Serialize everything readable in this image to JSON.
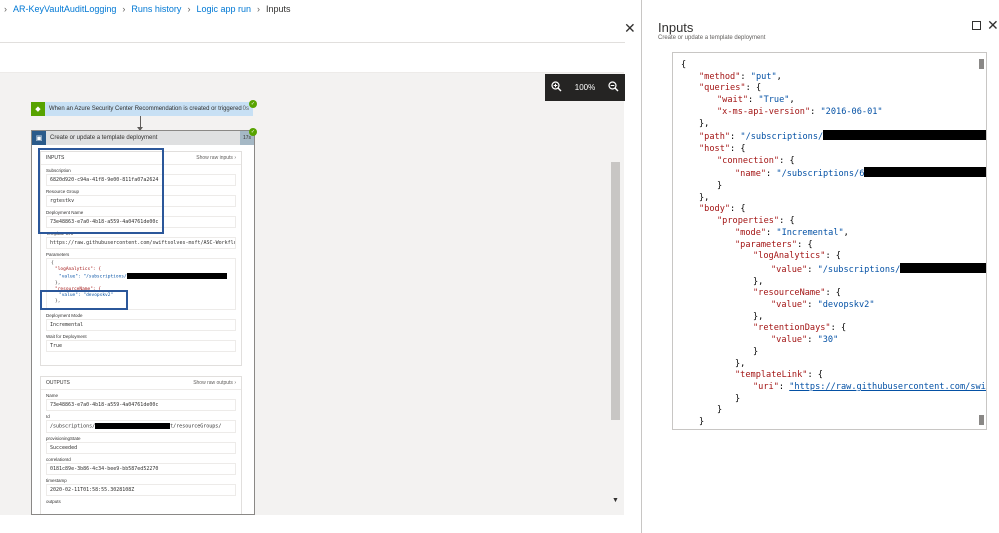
{
  "breadcrumb": [
    "AR-KeyVaultAuditLogging",
    "Runs history",
    "Logic app run",
    "Inputs"
  ],
  "designer": {
    "zoom_level": "100%",
    "trigger": {
      "title": "When an Azure Security Center Recommendation is created or triggered",
      "duration": "0s"
    },
    "action": {
      "title": "Create or update a template deployment",
      "duration": "17s",
      "inputs": {
        "title": "INPUTS",
        "show_raw": "Show raw inputs",
        "subscription_label": "Subscription",
        "subscription_value": "6820d920-c94a-41f8-9e00-811fa07a2624",
        "rg_label": "Resource Group",
        "rg_value": "rgtestkv",
        "deployment_label": "Deployment Name",
        "deployment_value": "73e48863-e7a0-4b18-a559-4a04761de00c",
        "template_uri_label": "Template URI",
        "template_uri_value": "https://raw.githubusercontent.com/swiftsolves-msft/ASC-Workflow-Aut",
        "parameters_label": "Parameters",
        "parameters_lines": [
          "{",
          "\"logAnalytics\": {",
          "\"value\": \"/subscriptions/",
          "},",
          "\"resourceName\": {",
          "\"value\": \"devopskv2\"",
          "},"
        ],
        "mode_label": "Deployment Mode",
        "mode_value": "Incremental",
        "wait_label": "Wait for Deployment",
        "wait_value": "True"
      },
      "outputs": {
        "title": "OUTPUTS",
        "show_raw": "Show raw outputs",
        "name_label": "Name",
        "name_value": "73e48863-e7a0-4b18-a559-4a04761de00c",
        "id_label": "Id",
        "id_value_prefix": "/subscriptions/",
        "id_value_suffix": "t/resourceGroups/",
        "state_label": "provisioningState",
        "state_value": "Succeeded",
        "corr_label": "correlationId",
        "corr_value": "0181c89e-3b86-4c34-bee9-bb587ed52270",
        "ts_label": "timestamp",
        "ts_value": "2020-02-11T01:58:55.3028108Z",
        "outputs_label": "outputs"
      }
    }
  },
  "inputs_panel": {
    "title": "Inputs",
    "subtitle": "Create or update a template deployment",
    "json_lines": [
      {
        "i": 0,
        "p": "{"
      },
      {
        "i": 1,
        "k": "\"method\"",
        "v": "\"put\"",
        "e": ","
      },
      {
        "i": 1,
        "k": "\"queries\"",
        "e": "{"
      },
      {
        "i": 2,
        "k": "\"wait\"",
        "v": "\"True\"",
        "e": ","
      },
      {
        "i": 2,
        "k": "\"x-ms-api-version\"",
        "v": "\"2016-06-01\""
      },
      {
        "i": 1,
        "p": "},"
      },
      {
        "i": 1,
        "k": "\"path\"",
        "v": "\"/subscriptions/",
        "r": 170,
        "t": "/r"
      },
      {
        "i": 1,
        "k": "\"host\"",
        "e": "{"
      },
      {
        "i": 2,
        "k": "\"connection\"",
        "e": "{"
      },
      {
        "i": 3,
        "k": "\"name\"",
        "v": "\"/subscriptions/6",
        "r": 140
      },
      {
        "i": 2,
        "p": "}"
      },
      {
        "i": 1,
        "p": "},"
      },
      {
        "i": 1,
        "k": "\"body\"",
        "e": "{"
      },
      {
        "i": 2,
        "k": "\"properties\"",
        "e": "{"
      },
      {
        "i": 3,
        "k": "\"mode\"",
        "v": "\"Incremental\"",
        "e": ","
      },
      {
        "i": 3,
        "k": "\"parameters\"",
        "e": "{"
      },
      {
        "i": 4,
        "k": "\"logAnalytics\"",
        "e": "{"
      },
      {
        "i": 5,
        "k": "\"value\"",
        "v": "\"/subscriptions/",
        "r": 100
      },
      {
        "i": 4,
        "p": "},"
      },
      {
        "i": 4,
        "k": "\"resourceName\"",
        "e": "{"
      },
      {
        "i": 5,
        "k": "\"value\"",
        "v": "\"devopskv2\""
      },
      {
        "i": 4,
        "p": "},"
      },
      {
        "i": 4,
        "k": "\"retentionDays\"",
        "e": "{"
      },
      {
        "i": 5,
        "k": "\"value\"",
        "v": "\"30\""
      },
      {
        "i": 4,
        "p": "}"
      },
      {
        "i": 3,
        "p": "},"
      },
      {
        "i": 3,
        "k": "\"templateLink\"",
        "e": "{"
      },
      {
        "i": 4,
        "k": "\"uri\"",
        "u": "\"https://raw.githubusercontent.com/swiftsol"
      },
      {
        "i": 3,
        "p": "}"
      },
      {
        "i": 2,
        "p": "}"
      },
      {
        "i": 1,
        "p": "}"
      },
      {
        "i": 0,
        "p": "}"
      }
    ]
  }
}
